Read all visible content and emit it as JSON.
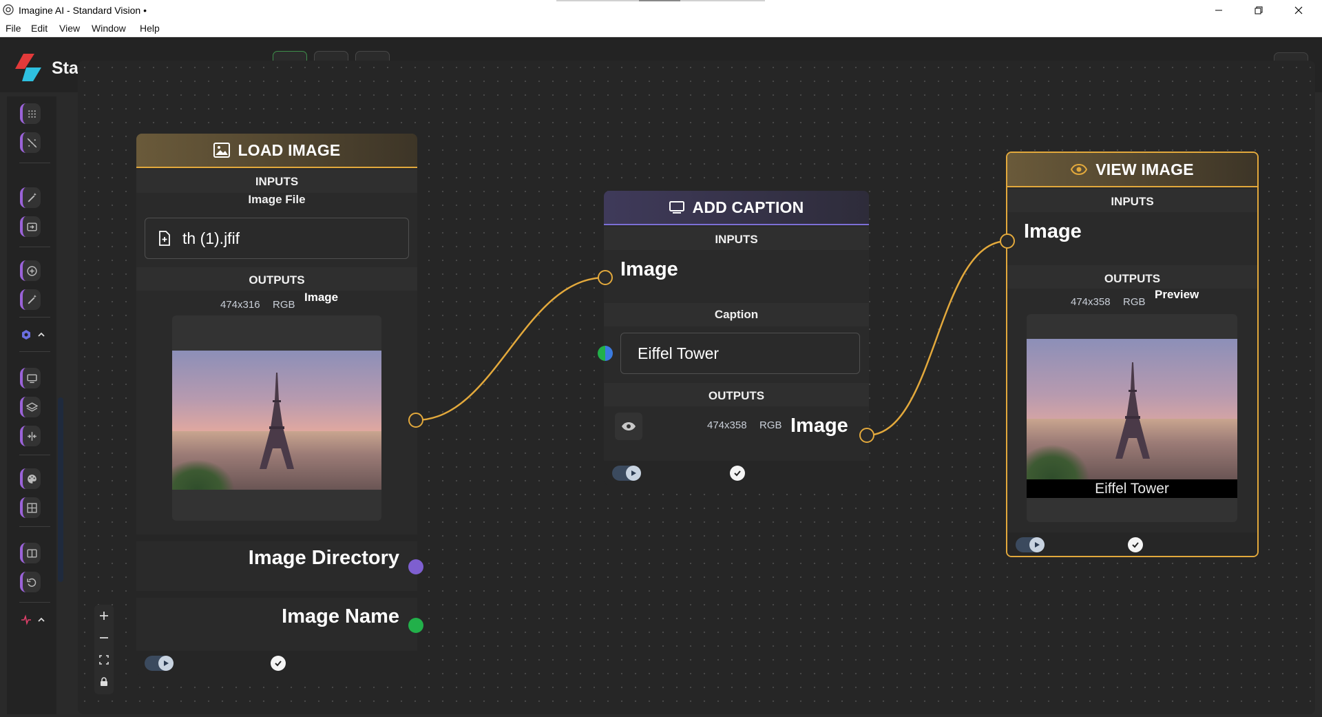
{
  "window": {
    "title": "Imagine AI - Standard Vision •"
  },
  "menu": [
    "File",
    "Edit",
    "View",
    "Window",
    "Help"
  ],
  "header": {
    "brand": "Standard Vision"
  },
  "nodes": {
    "load": {
      "title": "LOAD IMAGE",
      "inputs_label": "INPUTS",
      "file_label": "Image File",
      "file_name": "th (1).jfif",
      "outputs_label": "OUTPUTS",
      "dims": "474x316",
      "mode": "RGB",
      "image_label": "Image",
      "dir_label": "Image Directory",
      "name_label": "Image Name"
    },
    "caption": {
      "title": "ADD CAPTION",
      "inputs_label": "INPUTS",
      "image_label": "Image",
      "caption_label": "Caption",
      "caption_value": "Eiffel Tower",
      "outputs_label": "OUTPUTS",
      "dims": "474x358",
      "mode": "RGB",
      "out_image_label": "Image"
    },
    "view": {
      "title": "VIEW IMAGE",
      "inputs_label": "INPUTS",
      "image_label": "Image",
      "outputs_label": "OUTPUTS",
      "dims": "474x358",
      "mode": "RGB",
      "preview_label": "Preview",
      "preview_caption": "Eiffel Tower"
    }
  },
  "colors": {
    "accent_gold": "#e3a93c",
    "load_header": "#5c4e33",
    "caption_header": "#3a3550",
    "caption_underline": "#7c6fd6",
    "sidebar_accent": "#9b63d9",
    "dot_purple": "#7e5fd0",
    "dot_green": "#22b04a",
    "dot_blue": "#3b7be0"
  }
}
